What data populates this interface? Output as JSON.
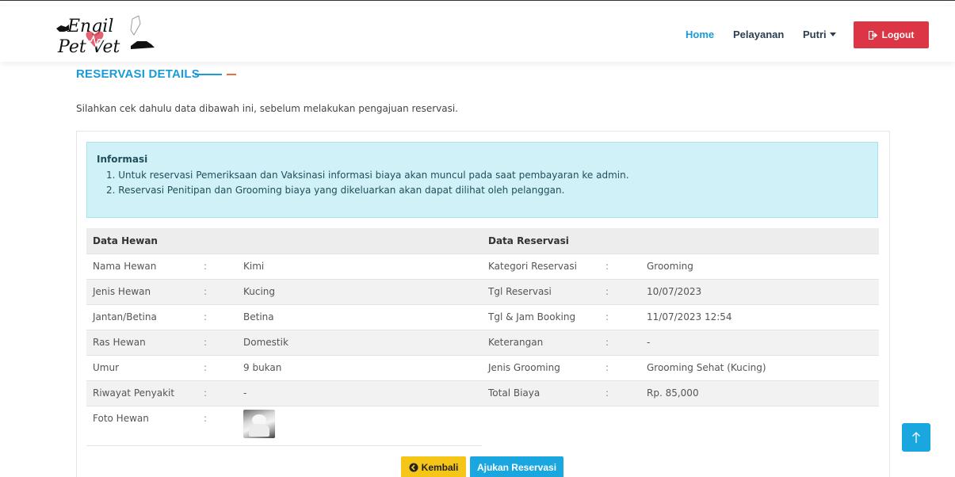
{
  "brand": {
    "logo_line1": "Engil",
    "logo_line2": "Pet Vet"
  },
  "nav": {
    "items": [
      {
        "label": "Home"
      },
      {
        "label": "Pelayanan"
      },
      {
        "label": "Putri"
      }
    ],
    "logout_label": "Logout",
    "active_color": "#1a9ad6"
  },
  "page": {
    "title": "RESERVASI DETAILS",
    "intro": "Silahkan cek dahulu data dibawah ini, sebelum melakukan pengajuan reservasi."
  },
  "info": {
    "title": "Informasi",
    "items": [
      "1. Untuk reservasi Pemeriksaan dan Vaksinasi informasi biaya akan muncul pada saat pembayaran ke admin.",
      "2. Reservasi Penitipan dan Grooming biaya yang dikeluarkan akan dapat dilihat oleh pelanggan."
    ]
  },
  "pet": {
    "header": "Data Hewan",
    "rows": [
      {
        "label": "Nama Hewan",
        "sep": ":",
        "value": "Kimi"
      },
      {
        "label": "Jenis Hewan",
        "sep": ":",
        "value": "Kucing"
      },
      {
        "label": "Jantan/Betina",
        "sep": ":",
        "value": "Betina"
      },
      {
        "label": "Ras Hewan",
        "sep": ":",
        "value": "Domestik"
      },
      {
        "label": "Umur",
        "sep": ":",
        "value": "9 bukan"
      },
      {
        "label": "Riwayat Penyakit",
        "sep": ":",
        "value": "-"
      },
      {
        "label": "Foto Hewan",
        "sep": ":",
        "value": ""
      }
    ]
  },
  "reservation": {
    "header": "Data Reservasi",
    "rows": [
      {
        "label": "Kategori Reservasi",
        "sep": ":",
        "value": "Grooming"
      },
      {
        "label": "Tgl Reservasi",
        "sep": ":",
        "value": "10/07/2023"
      },
      {
        "label": "Tgl & Jam Booking",
        "sep": ":",
        "value": "11/07/2023 12:54"
      },
      {
        "label": "Keterangan",
        "sep": ":",
        "value": "-"
      },
      {
        "label": "Jenis Grooming",
        "sep": ":",
        "value": "Grooming Sehat (Kucing)"
      },
      {
        "label": "Total Biaya",
        "sep": ":",
        "value": "Rp. 85,000"
      }
    ]
  },
  "actions": {
    "back_label": "Kembali",
    "submit_label": "Ajukan Reservasi"
  },
  "colors": {
    "primary": "#1aa7e0",
    "danger": "#dc3545",
    "warning": "#f5c518",
    "info_bg": "#d1f1f8"
  }
}
